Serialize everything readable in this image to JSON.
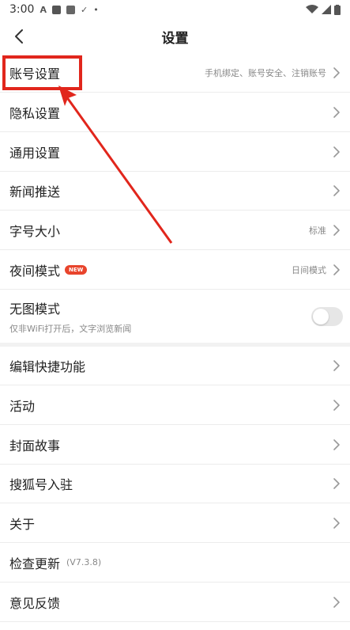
{
  "status": {
    "time": "3:00"
  },
  "header": {
    "title": "设置"
  },
  "settings": {
    "account": {
      "label": "账号设置",
      "hint": "手机绑定、账号安全、注销账号"
    },
    "privacy": {
      "label": "隐私设置"
    },
    "general": {
      "label": "通用设置"
    },
    "push": {
      "label": "新闻推送"
    },
    "font": {
      "label": "字号大小",
      "hint": "标准"
    },
    "night": {
      "label": "夜间模式",
      "badge": "NEW",
      "hint": "日间模式"
    },
    "noimage": {
      "label": "无图模式",
      "sub": "仅非WiFi打开后，文字浏览新闻",
      "enabled": false
    },
    "shortcut": {
      "label": "编辑快捷功能"
    },
    "activity": {
      "label": "活动"
    },
    "cover": {
      "label": "封面故事"
    },
    "sohu": {
      "label": "搜狐号入驻"
    },
    "about": {
      "label": "关于"
    },
    "update": {
      "label": "检查更新",
      "version": "(V7.3.8)"
    },
    "feedback": {
      "label": "意见反馈"
    }
  },
  "colors": {
    "accent": "#e1261c",
    "badge": "#e8442c"
  },
  "icons": [
    "back-icon",
    "chevron-right-icon",
    "wifi-icon",
    "signal-icon",
    "battery-icon"
  ]
}
